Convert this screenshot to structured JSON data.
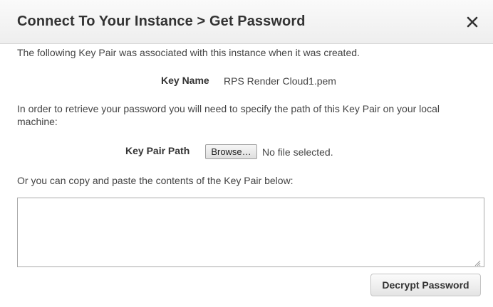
{
  "dialog": {
    "title": "Connect To Your Instance > Get Password",
    "close_icon": "close-icon"
  },
  "intro_text": "The following Key Pair was associated with this instance when it was created.",
  "key_name": {
    "label": "Key Name",
    "value": "RPS Render Cloud1.pem"
  },
  "instructions": {
    "line1": "In order to retrieve your password you will need to specify the path of this Key Pair on your local",
    "line2": "machine:"
  },
  "key_pair_path": {
    "label": "Key Pair Path",
    "browse_label": "Browse…",
    "file_status": "No file selected."
  },
  "paste_text": "Or you can copy and paste the contents of the Key Pair below:",
  "key_contents": {
    "value": "",
    "placeholder": ""
  },
  "decrypt_button_label": "Decrypt Password"
}
